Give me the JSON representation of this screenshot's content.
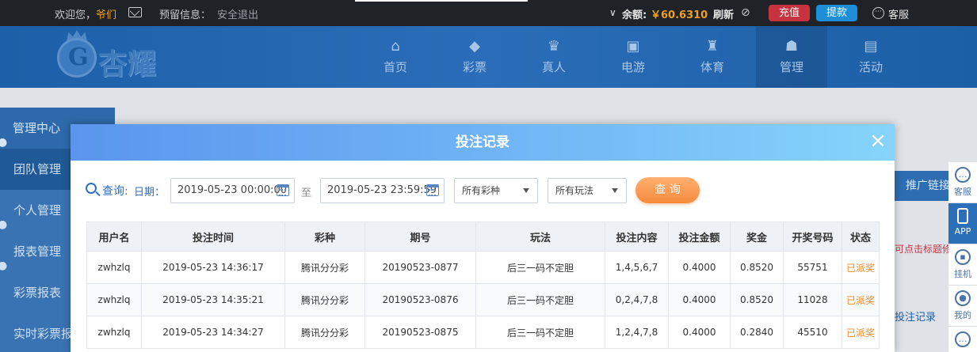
{
  "topbar": {
    "welcome": "欢迎您，",
    "username": "爷们",
    "reserved_info": "预留信息：",
    "logout": "安全退出",
    "balance_label": "余额:",
    "balance_value": "￥60.6310",
    "refresh": "刷新",
    "charge": "充值",
    "withdraw": "提款",
    "customer_service": "客服",
    "colors": {
      "charge": "#c8333f",
      "withdraw": "#1d8fd8",
      "accent": "#f0a020"
    }
  },
  "logo": {
    "text": "杏耀"
  },
  "nav": [
    {
      "label": "首页",
      "icon": "home-icon",
      "glyph": "⌂"
    },
    {
      "label": "彩票",
      "icon": "lottery-icon",
      "glyph": "◆"
    },
    {
      "label": "真人",
      "icon": "live-icon",
      "glyph": "♛"
    },
    {
      "label": "电游",
      "icon": "slots-icon",
      "glyph": "▣"
    },
    {
      "label": "体育",
      "icon": "trophy-icon",
      "glyph": "♜"
    },
    {
      "label": "管理",
      "icon": "users-icon",
      "glyph": "☗"
    },
    {
      "label": "活动",
      "icon": "gift-icon",
      "glyph": "▤"
    }
  ],
  "sidebar": {
    "head": "管理中心",
    "items": [
      "团队管理",
      "个人管理",
      "报表管理",
      "彩票报表",
      "实时彩票报"
    ]
  },
  "background": {
    "promo_button": "推广链接",
    "hint": "可点击标题修改",
    "record_link": "投注记录",
    "tools": [
      {
        "label": "客服",
        "icon": "chat-icon"
      },
      {
        "label": "APP",
        "icon": "phone-icon"
      },
      {
        "label": "挂机",
        "icon": "robot-icon"
      },
      {
        "label": "我的",
        "icon": "user-icon"
      },
      {
        "label": "",
        "icon": "message-icon"
      }
    ]
  },
  "modal": {
    "title": "投注记录",
    "close": "×",
    "filter": {
      "query_label": "查询:",
      "date_label": "日期：",
      "start_date": "2019-05-23 00:00:00",
      "to_label": "至",
      "end_date": "2019-05-23 23:59:59",
      "lottery_select": "所有彩种",
      "play_select": "所有玩法",
      "query_button": "查 询"
    },
    "table": {
      "headers": [
        "用户名",
        "投注时间",
        "彩种",
        "期号",
        "玩法",
        "投注内容",
        "投注金额",
        "奖金",
        "开奖号码",
        "状态"
      ],
      "rows": [
        [
          "zwhzlq",
          "2019-05-23 14:36:17",
          "腾讯分分彩",
          "20190523-0877",
          "后三一码不定胆",
          "1,4,5,6,7",
          "0.4000",
          "0.8520",
          "55751",
          "已派奖"
        ],
        [
          "zwhzlq",
          "2019-05-23 14:35:21",
          "腾讯分分彩",
          "20190523-0876",
          "后三一码不定胆",
          "0,2,4,7,8",
          "0.4000",
          "0.8520",
          "11028",
          "已派奖"
        ],
        [
          "zwhzlq",
          "2019-05-23 14:34:27",
          "腾讯分分彩",
          "20190523-0875",
          "后三一码不定胆",
          "1,2,4,7,8",
          "0.4000",
          "0.2840",
          "45510",
          "已派奖"
        ]
      ]
    }
  }
}
